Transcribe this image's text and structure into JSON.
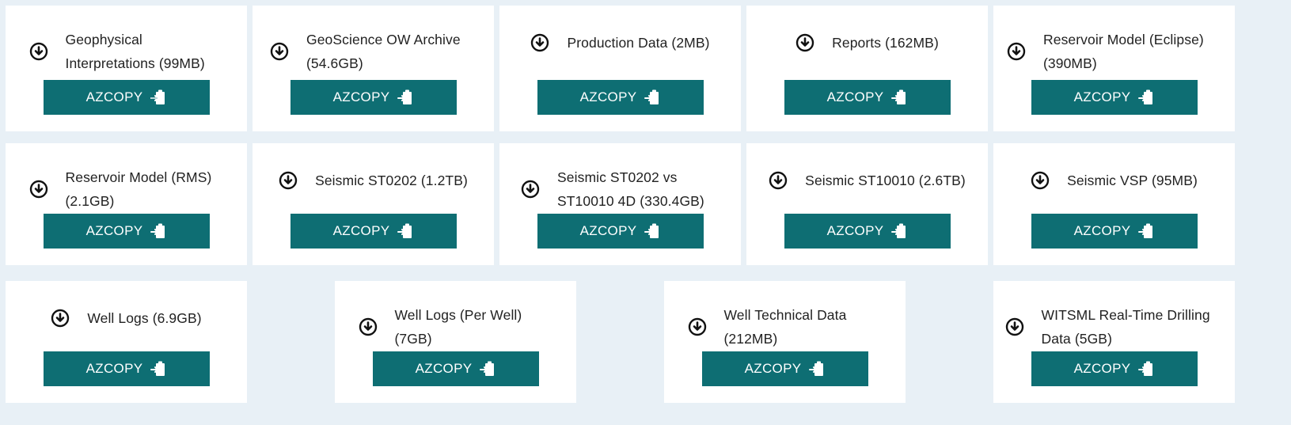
{
  "button_label": "AZCOPY",
  "colors": {
    "background": "#e8f0f6",
    "card": "#ffffff",
    "button": "#0e6e73",
    "text": "#222222"
  },
  "icons": {
    "download": "download-circle-icon",
    "copy": "clipboard-copy-icon"
  },
  "datasets": [
    {
      "title": "Geophysical Interpretations (99MB)"
    },
    {
      "title": "GeoScience OW Archive (54.6GB)"
    },
    {
      "title": "Production Data (2MB)"
    },
    {
      "title": "Reports (162MB)"
    },
    {
      "title": "Reservoir Model (Eclipse) (390MB)"
    },
    {
      "title": "Reservoir Model (RMS) (2.1GB)"
    },
    {
      "title": "Seismic ST0202 (1.2TB)"
    },
    {
      "title": "Seismic ST0202 vs ST10010 4D (330.4GB)"
    },
    {
      "title": "Seismic ST10010 (2.6TB)"
    },
    {
      "title": "Seismic VSP (95MB)"
    },
    {
      "title": "Well Logs (6.9GB)"
    },
    {
      "title": "Well Logs (Per Well) (7GB)"
    },
    {
      "title": "Well Technical Data (212MB)"
    },
    {
      "title": "WITSML Real-Time Drilling Data (5GB)"
    }
  ]
}
